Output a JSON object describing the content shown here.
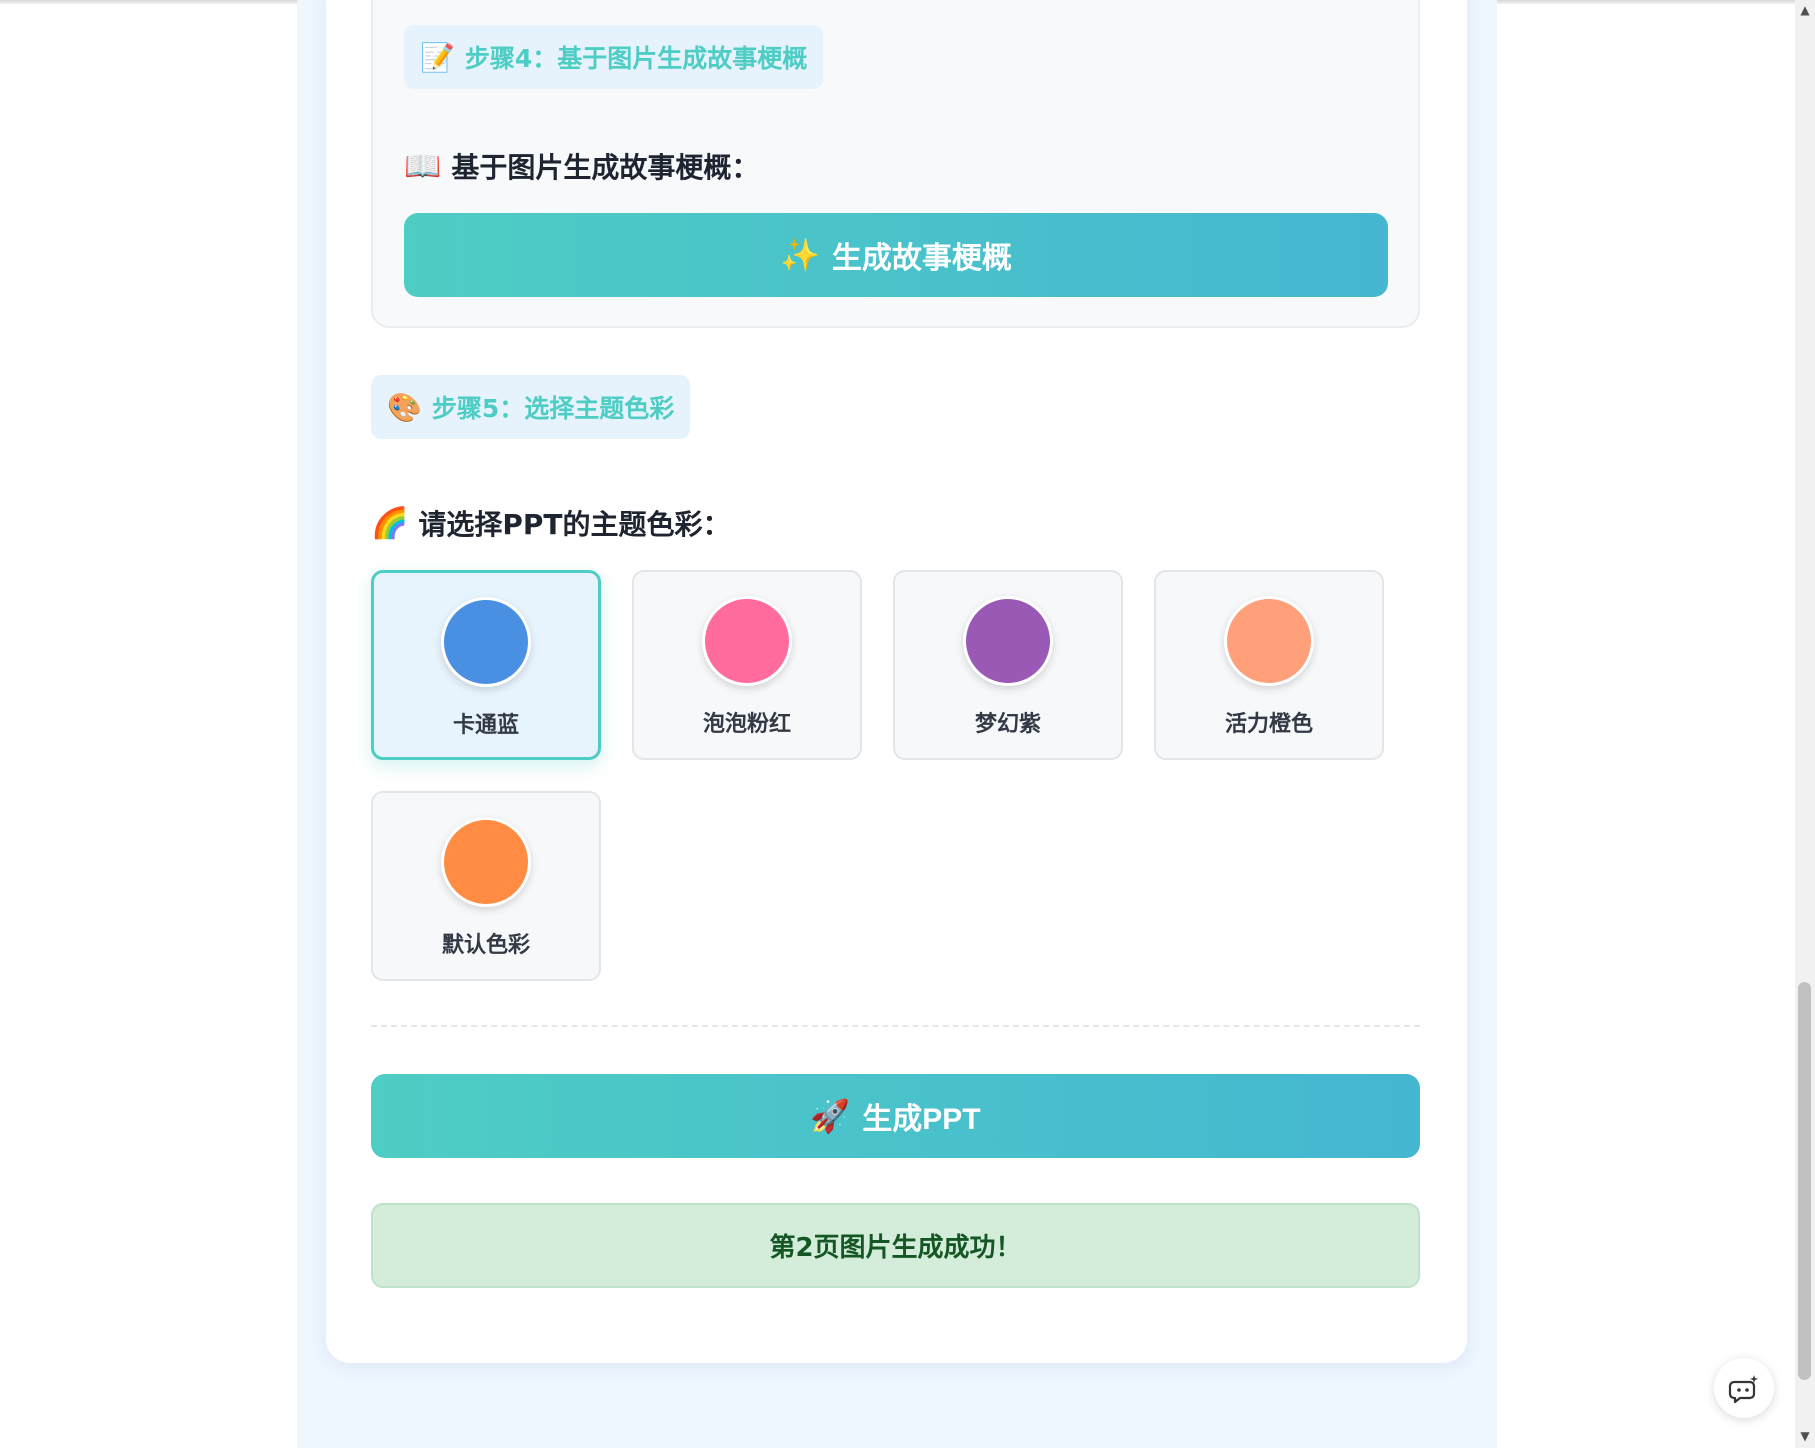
{
  "step4": {
    "emoji": "📝",
    "label": "步骤4：基于图片生成故事梗概",
    "heading_emoji": "📖",
    "heading": "基于图片生成故事梗概：",
    "button_emoji": "✨",
    "button_label": "生成故事梗概"
  },
  "step5": {
    "emoji": "🎨",
    "label": "步骤5：选择主题色彩",
    "heading_emoji": "🌈",
    "heading": "请选择PPT的主题色彩：",
    "themes": [
      {
        "name": "卡通蓝",
        "color": "#4a90e2",
        "selected": true
      },
      {
        "name": "泡泡粉红",
        "color": "#ff6b9d",
        "selected": false
      },
      {
        "name": "梦幻紫",
        "color": "#9b59b6",
        "selected": false
      },
      {
        "name": "活力橙色",
        "color": "#ffa07a",
        "selected": false
      },
      {
        "name": "默认色彩",
        "color": "#ff8c42",
        "selected": false
      }
    ]
  },
  "generate": {
    "emoji": "🚀",
    "label": "生成PPT"
  },
  "status": {
    "message": "第2页图片生成成功！"
  },
  "colors": {
    "accent": "#4ecdc4",
    "accent_end": "#45b7d1",
    "success_bg": "#d4edda",
    "success_text": "#155724"
  }
}
